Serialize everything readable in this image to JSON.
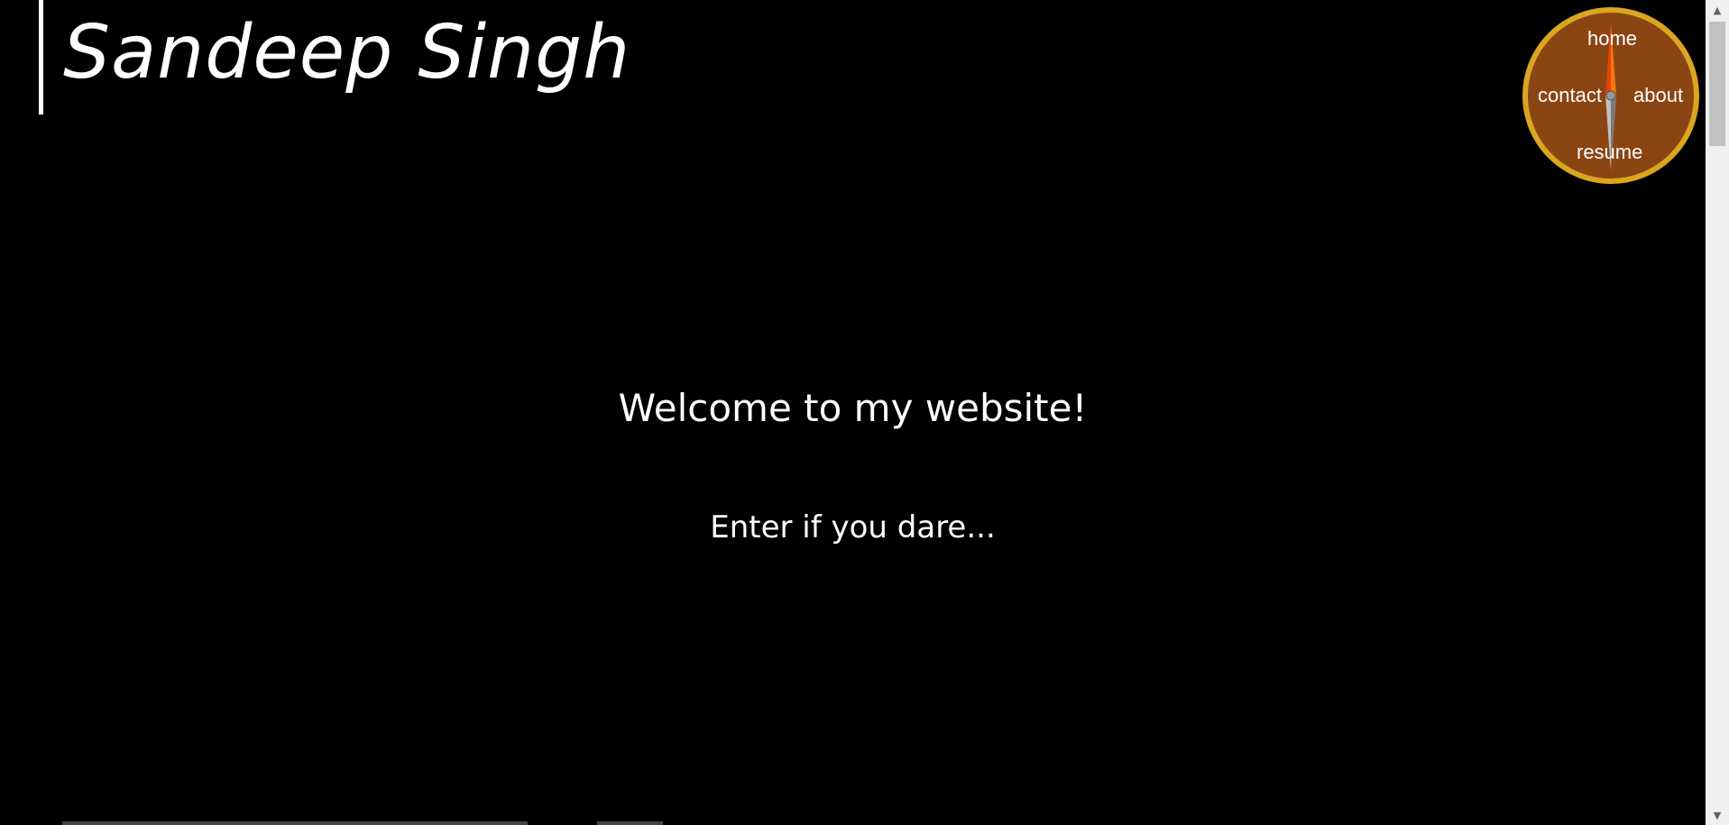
{
  "header": {
    "title": "Sandeep Singh"
  },
  "main": {
    "welcome": "Welcome to my website!",
    "tagline": "Enter if you dare..."
  },
  "compass_nav": {
    "items": [
      {
        "label": "home"
      },
      {
        "label": "about"
      },
      {
        "label": "contact"
      },
      {
        "label": "resume"
      }
    ],
    "colors": {
      "face": "#8B4513",
      "rim": "#DAA520",
      "needle_north": "#E8400C",
      "needle_south": "#C0C0C0"
    }
  },
  "scrollbar": {
    "icons": [
      "scroll-up-arrow-icon",
      "scroll-down-arrow-icon"
    ]
  }
}
